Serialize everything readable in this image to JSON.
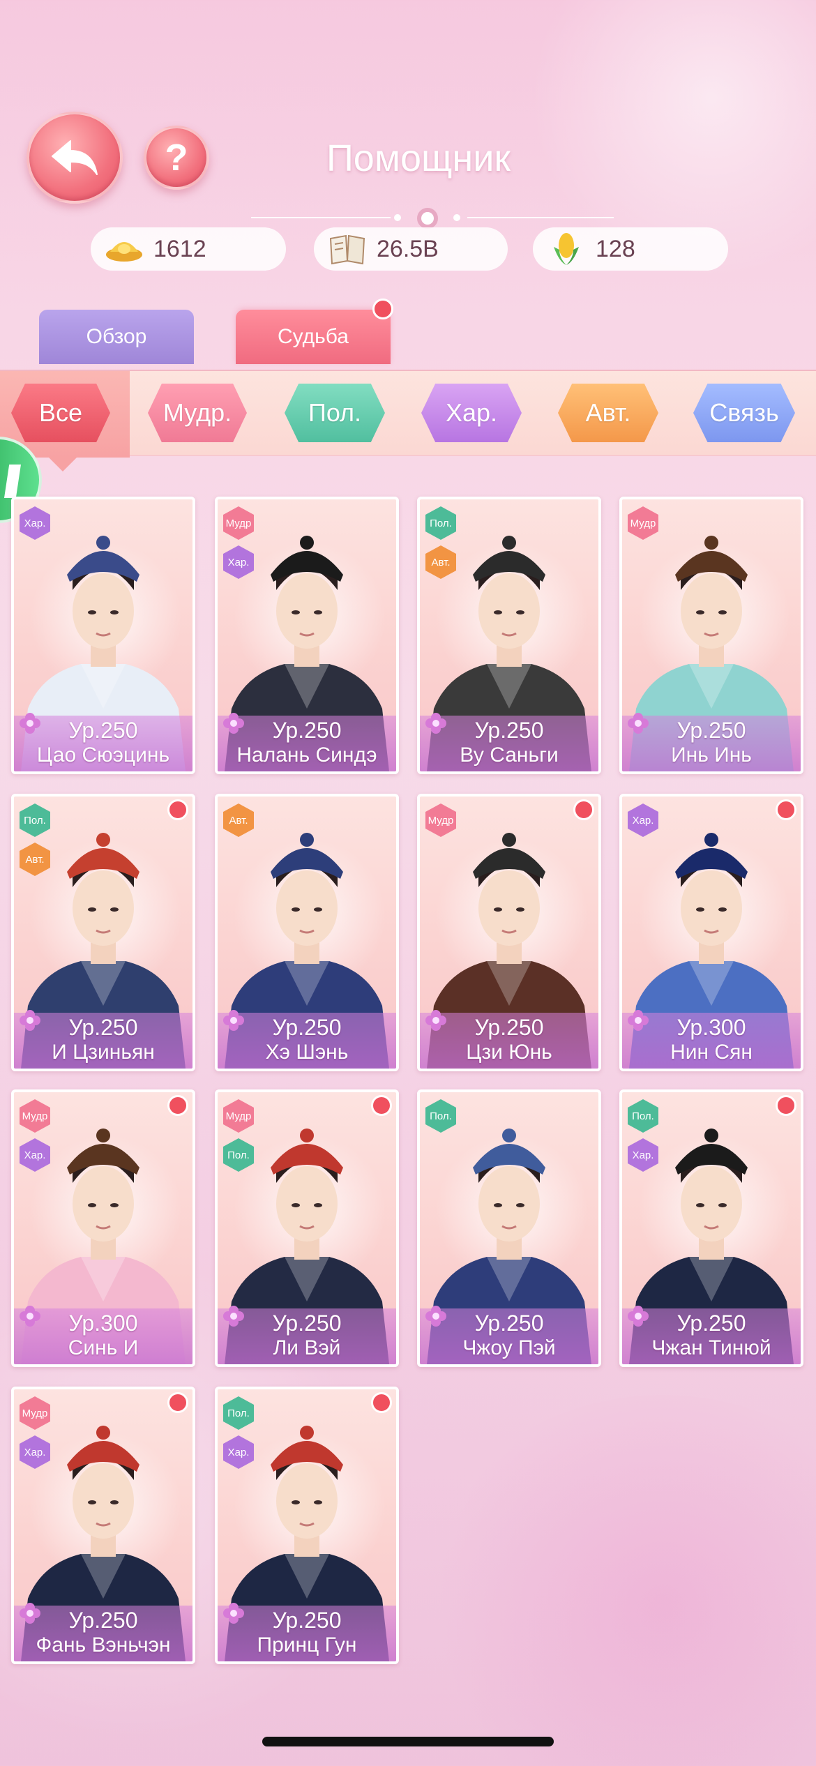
{
  "header": {
    "title": "Помощник",
    "back_icon": "back-arrow-icon",
    "help_label": "?"
  },
  "resources": [
    {
      "icon": "gold-ingot-icon",
      "value": "1612"
    },
    {
      "icon": "book-icon",
      "value": "26.5B"
    },
    {
      "icon": "corn-icon",
      "value": "128"
    }
  ],
  "tabs": [
    {
      "label": "Обзор",
      "active": false
    },
    {
      "label": "Судьба",
      "active": true,
      "notification": true
    }
  ],
  "filters": [
    {
      "label": "Все",
      "selected": true
    },
    {
      "label": "Мудр."
    },
    {
      "label": "Пол."
    },
    {
      "label": "Хар."
    },
    {
      "label": "Авт."
    },
    {
      "label": "Связь"
    }
  ],
  "colors": {
    "accent": "#f06b80",
    "wisdom": "#f27b95",
    "politics": "#4dbb98",
    "charm": "#b274dd",
    "authority": "#f29443",
    "connection": "#7d97ef"
  },
  "cards": [
    {
      "level": "Ур.250",
      "name": "Цао Сюэцинь",
      "badges": [
        "Хар."
      ],
      "dot": false
    },
    {
      "level": "Ур.250",
      "name": "Налань Синдэ",
      "badges": [
        "Мудр",
        "Хар."
      ],
      "dot": false
    },
    {
      "level": "Ур.250",
      "name": "Ву Саньги",
      "badges": [
        "Пол.",
        "Авт."
      ],
      "dot": false
    },
    {
      "level": "Ур.250",
      "name": "Инь Инь",
      "badges": [
        "Мудр"
      ],
      "dot": false
    },
    {
      "level": "Ур.250",
      "name": "И Цзиньян",
      "badges": [
        "Пол.",
        "Авт."
      ],
      "dot": true
    },
    {
      "level": "Ур.250",
      "name": "Хэ Шэнь",
      "badges": [
        "Авт."
      ],
      "dot": false
    },
    {
      "level": "Ур.250",
      "name": "Цзи Юнь",
      "badges": [
        "Мудр"
      ],
      "dot": true
    },
    {
      "level": "Ур.300",
      "name": "Нин Сян",
      "badges": [
        "Хар."
      ],
      "dot": true
    },
    {
      "level": "Ур.300",
      "name": "Синь И",
      "badges": [
        "Мудр",
        "Хар."
      ],
      "dot": true
    },
    {
      "level": "Ур.250",
      "name": "Ли Вэй",
      "badges": [
        "Мудр",
        "Пол."
      ],
      "dot": true
    },
    {
      "level": "Ур.250",
      "name": "Чжоу Пэй",
      "badges": [
        "Пол."
      ],
      "dot": false
    },
    {
      "level": "Ур.250",
      "name": "Чжан Тинюй",
      "badges": [
        "Пол.",
        "Хар."
      ],
      "dot": true
    },
    {
      "level": "Ур.250",
      "name": "Фань Вэньчэн",
      "badges": [
        "Мудр",
        "Хар."
      ],
      "dot": true
    },
    {
      "level": "Ур.250",
      "name": "Принц Гун",
      "badges": [
        "Пол.",
        "Хар."
      ],
      "dot": true
    }
  ]
}
